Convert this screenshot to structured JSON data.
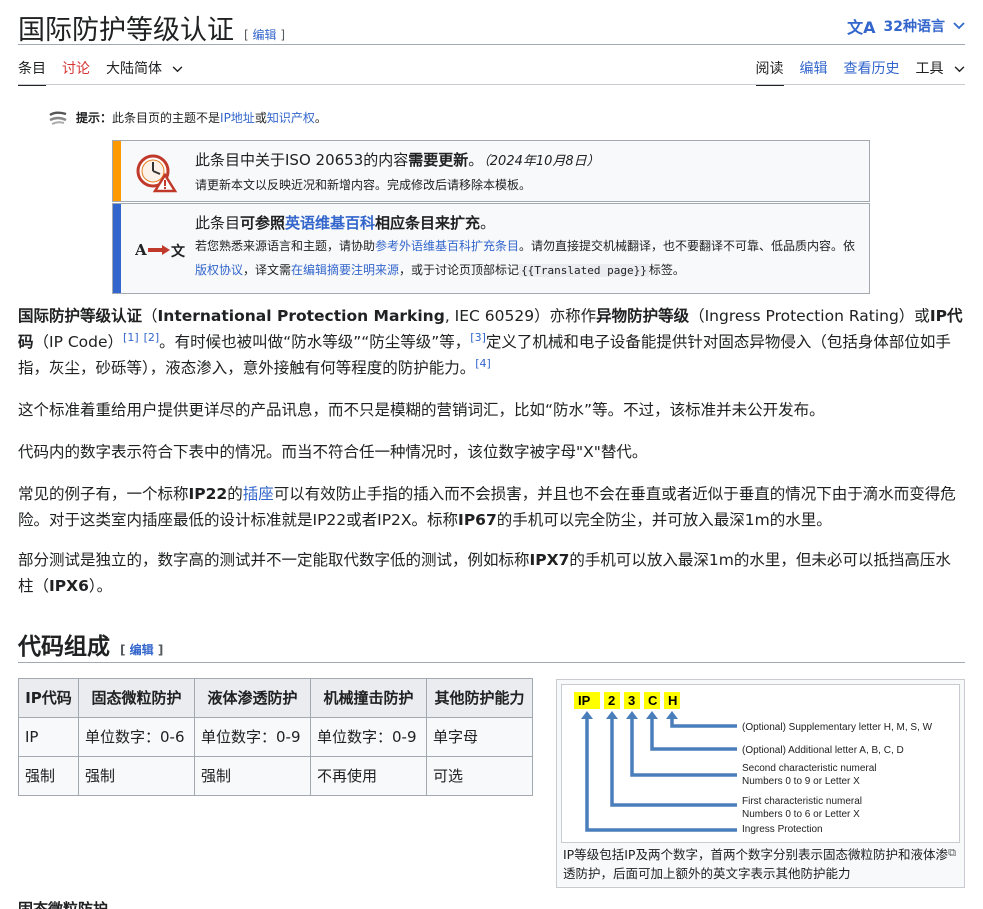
{
  "header": {
    "title": "国际防护等级认证",
    "edit_label": "编辑",
    "lang_count": "32种语言"
  },
  "tabs_left": [
    {
      "label": "条目"
    },
    {
      "label": "讨论"
    },
    {
      "label": "大陆简体"
    }
  ],
  "tabs_right": [
    {
      "label": "阅读"
    },
    {
      "label": "编辑"
    },
    {
      "label": "查看历史"
    },
    {
      "label": "工具"
    }
  ],
  "hatnote": {
    "prefix": "提示：",
    "text1": "此条目页的主题不是",
    "link1": "IP地址",
    "or": "或",
    "link2": "知识产权",
    "end": "。"
  },
  "ambox1": {
    "main1": "此条目中关于ISO 20653的内容",
    "main_bold": "需要更新",
    "main2": "。",
    "date": "（2024年10月8日）",
    "sub": "请更新本文以反映近况和新增内容。完成修改后请移除本模板。"
  },
  "ambox2": {
    "main1": "此条目",
    "main_bold1": "可参照",
    "main_link": "英语维基百科",
    "main_bold2": "相应条目来扩充",
    "main2": "。",
    "sub1": "若您熟悉来源语言和主题，请协助",
    "sub_link1": "参考外语维基百科扩充条目",
    "sub2": "。请勿直接提交机械翻译，也不要翻译不可靠、低品质内容。依",
    "sub_link2": "版权协议",
    "sub3": "，译文需",
    "sub_link3": "在编辑摘要注明来源",
    "sub4": "，或于讨论页顶部标记",
    "sub_code": "{{Translated page}}",
    "sub5": "标签。"
  },
  "para1": {
    "b1": "国际防护等级认证",
    "t1": "（",
    "b2": "International Protection Marking",
    "t2": ", IEC 60529）亦称作",
    "b3": "异物防护等级",
    "t3": "（Ingress Protection Rating）或",
    "b4": "IP代码",
    "t4": "（IP Code）",
    "ref1": "[1]",
    "ref2": "[2]",
    "t5": "。有时候也被叫做“防水等级”“防尘等级”等，",
    "ref3": "[3]",
    "t6": "定义了机械和电子设备能提供针对固态异物侵入（包括身体部位如手指，灰尘，砂砾等），液态渗入，意外接触有何等程度的防护能力。",
    "ref4": "[4]"
  },
  "para2": "这个标准着重给用户提供更详尽的产品讯息，而不只是模糊的营销词汇，比如“防水”等。不过，该标准并未公开发布。",
  "para3": "代码内的数字表示符合下表中的情况。而当不符合任一种情况时，该位数字被字母\"X\"替代。",
  "para4": {
    "t1": "常见的例子有，一个标称",
    "b1": "IP22",
    "t2": "的",
    "link": "插座",
    "t3": "可以有效防止手指的插入而不会损害，并且也不会在垂直或者近似于垂直的情况下由于滴水而变得危险。对于这类室内插座最低的设计标准就是IP22或者IP2X。标称",
    "b2": "IP67",
    "t4": "的手机可以完全防尘，并可放入最深1m的水里。"
  },
  "para5": {
    "t1": "部分测试是独立的，数字高的测试并不一定能取代数字低的测试，例如标称",
    "b1": "IPX7",
    "t2": "的手机可以放入最深1m的水里，但未必可以抵挡高压水柱（",
    "b2": "IPX6",
    "t3": "）。"
  },
  "section": {
    "title": "代码组成",
    "edit_label": "编辑"
  },
  "table": {
    "headers": [
      "IP代码",
      "固态微粒防护",
      "液体渗透防护",
      "机械撞击防护",
      "其他防护能力"
    ],
    "rows": [
      [
        "IP",
        "单位数字：0-6",
        "单位数字：0-9",
        "单位数字：0-9",
        "单字母"
      ],
      [
        "强制",
        "强制",
        "强制",
        "不再使用",
        "可选"
      ]
    ]
  },
  "figure": {
    "code_letters": [
      "IP",
      "2",
      "3",
      "C",
      "H"
    ],
    "labels": {
      "l1": "(Optional) Supplementary  letter H, M, S, W",
      "l2": "(Optional) Additional letter A, B, C, D",
      "l3a": "Second characteristic numeral",
      "l3b": "Numbers  0 to 9 or Letter X",
      "l4a": "First characteristic numeral",
      "l4b": "Numbers  0 to 6 or Letter X",
      "l5": "Ingress Protection"
    },
    "caption": "IP等级包括IP及两个数字，首两个数字分别表示固态微粒防护和液体渗透防护，后面可加上额外的英文字表示其他防护能力",
    "colors": {
      "code_bg": "#ffff00",
      "arrows": "#4a7ebb"
    }
  },
  "cut_heading": "固态微粒防护"
}
